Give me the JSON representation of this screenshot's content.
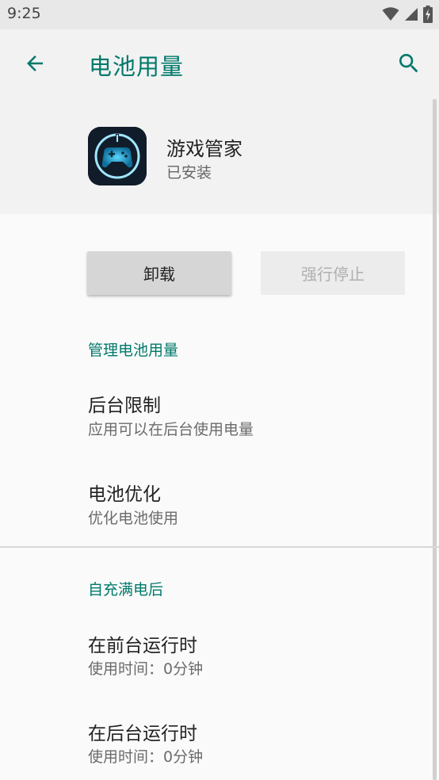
{
  "status_bar": {
    "time": "9:25",
    "icons": [
      "wifi-icon",
      "signal-icon",
      "battery-charging-icon"
    ]
  },
  "app_bar": {
    "title": "电池用量",
    "back_icon": "arrow-back-icon",
    "search_icon": "search-icon",
    "accent_color": "#00796b"
  },
  "app": {
    "name": "游戏管家",
    "status": "已安装",
    "icon": "gamepad-app-icon"
  },
  "buttons": {
    "uninstall_label": "卸载",
    "force_stop_label": "强行停止"
  },
  "sections": {
    "manage": {
      "header": "管理电池用量",
      "items": [
        {
          "title": "后台限制",
          "subtitle": "应用可以在后台使用电量"
        },
        {
          "title": "电池优化",
          "subtitle": "优化电池使用"
        }
      ]
    },
    "since_full_charge": {
      "header": "自充满电后",
      "items": [
        {
          "title": "在前台运行时",
          "subtitle": "使用时间：0分钟"
        },
        {
          "title": "在后台运行时",
          "subtitle": "使用时间：0分钟"
        }
      ]
    }
  }
}
